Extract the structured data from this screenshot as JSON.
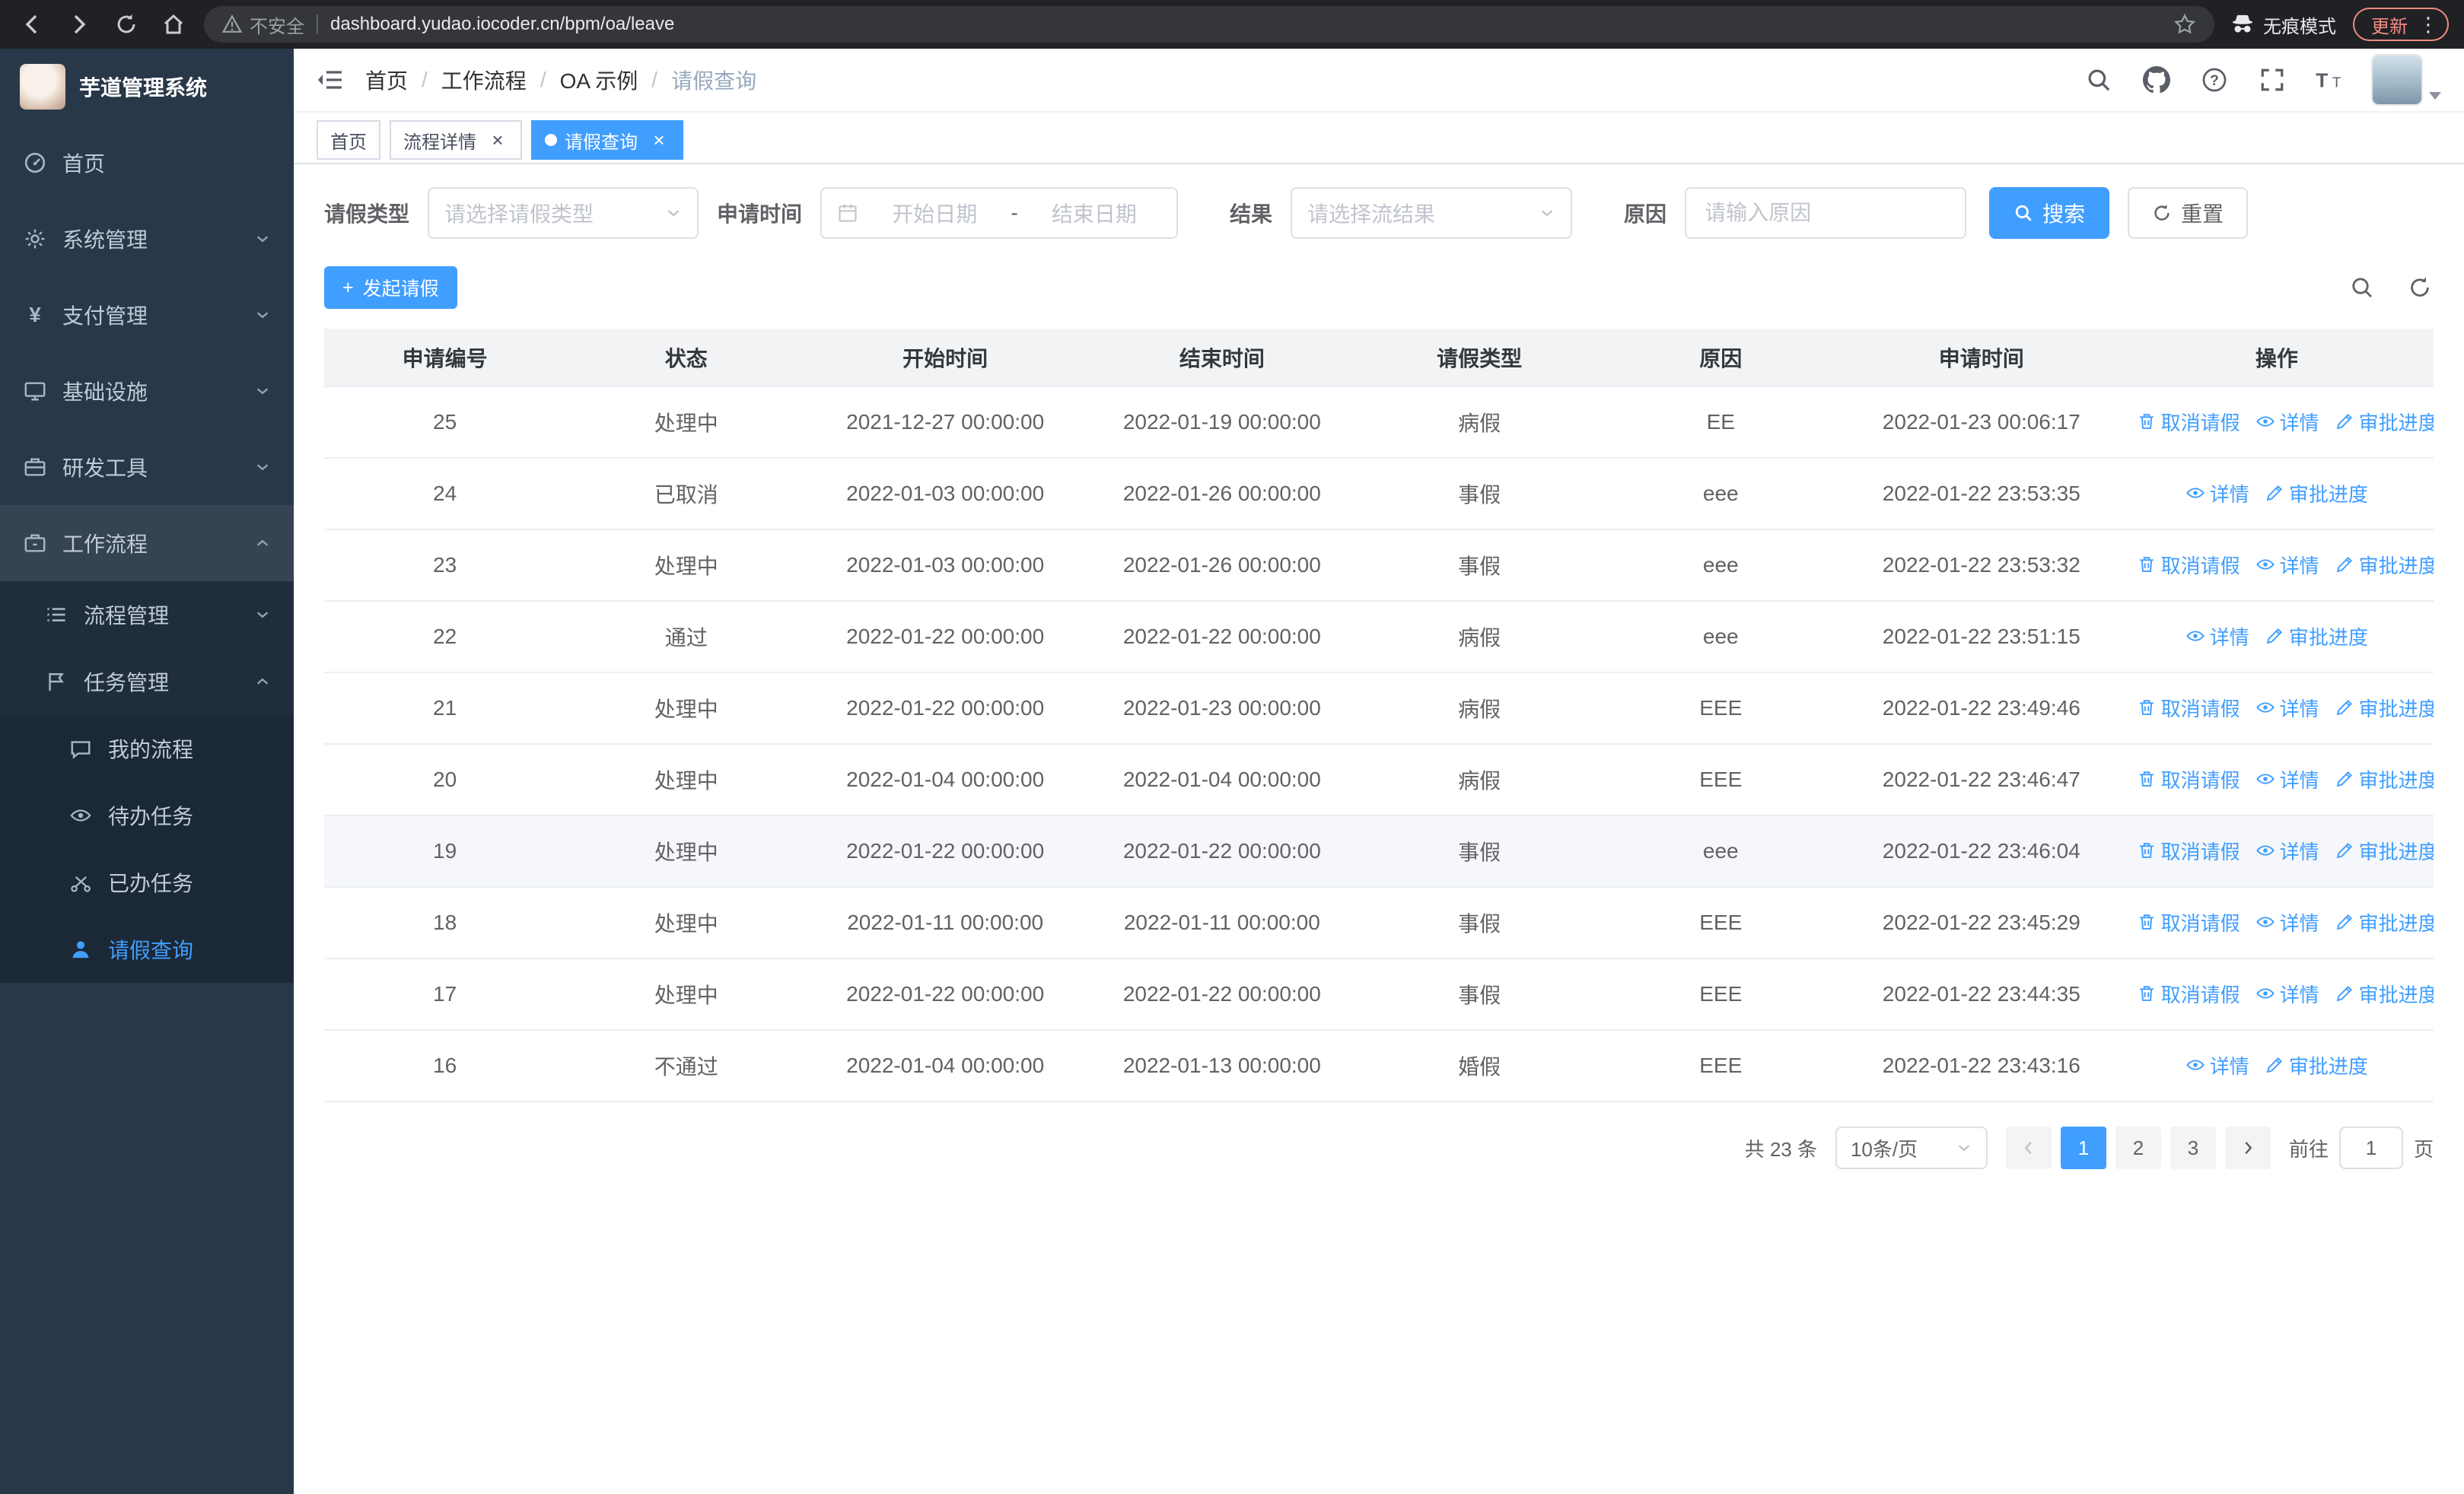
{
  "colors": {
    "accent": "#409eff",
    "sidebar_bg": "#293848",
    "submenu_bg": "#1f2d3d",
    "chrome_bg": "#202124",
    "table_header_bg": "#f2f3f5"
  },
  "browser": {
    "security_label": "不安全",
    "url": "dashboard.yudao.iocoder.cn/bpm/oa/leave",
    "incognito_label": "无痕模式",
    "update_label": "更新"
  },
  "sidebar": {
    "title": "芋道管理系统",
    "menu": [
      {
        "id": "home",
        "label": "首页",
        "icon": "dashboard-icon",
        "level": 1
      },
      {
        "id": "system",
        "label": "系统管理",
        "icon": "gear-icon",
        "level": 1,
        "chevron": "down"
      },
      {
        "id": "payment",
        "label": "支付管理",
        "icon": "payment-icon",
        "level": 1,
        "chevron": "down"
      },
      {
        "id": "infrastructure",
        "label": "基础设施",
        "icon": "infrastructure-icon",
        "level": 1,
        "chevron": "down"
      },
      {
        "id": "devtools",
        "label": "研发工具",
        "icon": "devtools-icon",
        "level": 1,
        "chevron": "down"
      },
      {
        "id": "workflow",
        "label": "工作流程",
        "icon": "workflow-icon",
        "level": 1,
        "chevron": "up",
        "parent_active": true
      },
      {
        "id": "process-management",
        "label": "流程管理",
        "icon": "process-icon",
        "level": 2,
        "chevron": "down"
      },
      {
        "id": "task-management",
        "label": "任务管理",
        "icon": "task-icon",
        "level": 2,
        "chevron": "up"
      },
      {
        "id": "my-process",
        "label": "我的流程",
        "icon": "chat-icon",
        "level": 3
      },
      {
        "id": "todo-tasks",
        "label": "待办任务",
        "icon": "eye-icon",
        "level": 3
      },
      {
        "id": "done-tasks",
        "label": "已办任务",
        "icon": "scissors-icon",
        "level": 3
      },
      {
        "id": "leave-query",
        "label": "请假查询",
        "icon": "user-icon",
        "level": 3,
        "active": true
      }
    ]
  },
  "header": {
    "breadcrumb": [
      "首页",
      "工作流程",
      "OA 示例",
      "请假查询"
    ]
  },
  "tags": [
    {
      "id": "home",
      "label": "首页",
      "active": false,
      "closable": false,
      "dot": false
    },
    {
      "id": "process-detail",
      "label": "流程详情",
      "active": false,
      "closable": true,
      "dot": false
    },
    {
      "id": "leave-query",
      "label": "请假查询",
      "active": true,
      "closable": true,
      "dot": true
    }
  ],
  "filters": {
    "leave_type_label": "请假类型",
    "leave_type_placeholder": "请选择请假类型",
    "apply_time_label": "申请时间",
    "start_date_placeholder": "开始日期",
    "range_separator": "-",
    "end_date_placeholder": "结束日期",
    "result_label": "结果",
    "result_placeholder": "请选择流结果",
    "reason_label": "原因",
    "reason_placeholder": "请输入原因",
    "search_label": "搜索",
    "reset_label": "重置"
  },
  "toolbar": {
    "create_label": "发起请假"
  },
  "table": {
    "columns": [
      "申请编号",
      "状态",
      "开始时间",
      "结束时间",
      "请假类型",
      "原因",
      "申请时间",
      "操作"
    ],
    "action_defs": {
      "cancel": {
        "label": "取消请假",
        "icon": "delete-icon"
      },
      "detail": {
        "label": "详情",
        "icon": "view-icon"
      },
      "progress": {
        "label": "审批进度",
        "icon": "edit-icon"
      }
    },
    "rows": [
      {
        "id": "25",
        "status": "处理中",
        "start_time": "2021-12-27 00:00:00",
        "end_time": "2022-01-19 00:00:00",
        "leave_type": "病假",
        "reason": "EE",
        "apply_time": "2022-01-23 00:06:17",
        "actions": [
          "cancel",
          "detail",
          "progress"
        ]
      },
      {
        "id": "24",
        "status": "已取消",
        "start_time": "2022-01-03 00:00:00",
        "end_time": "2022-01-26 00:00:00",
        "leave_type": "事假",
        "reason": "eee",
        "apply_time": "2022-01-22 23:53:35",
        "actions": [
          "detail",
          "progress"
        ]
      },
      {
        "id": "23",
        "status": "处理中",
        "start_time": "2022-01-03 00:00:00",
        "end_time": "2022-01-26 00:00:00",
        "leave_type": "事假",
        "reason": "eee",
        "apply_time": "2022-01-22 23:53:32",
        "actions": [
          "cancel",
          "detail",
          "progress"
        ]
      },
      {
        "id": "22",
        "status": "通过",
        "start_time": "2022-01-22 00:00:00",
        "end_time": "2022-01-22 00:00:00",
        "leave_type": "病假",
        "reason": "eee",
        "apply_time": "2022-01-22 23:51:15",
        "actions": [
          "detail",
          "progress"
        ]
      },
      {
        "id": "21",
        "status": "处理中",
        "start_time": "2022-01-22 00:00:00",
        "end_time": "2022-01-23 00:00:00",
        "leave_type": "病假",
        "reason": "EEE",
        "apply_time": "2022-01-22 23:49:46",
        "actions": [
          "cancel",
          "detail",
          "progress"
        ]
      },
      {
        "id": "20",
        "status": "处理中",
        "start_time": "2022-01-04 00:00:00",
        "end_time": "2022-01-04 00:00:00",
        "leave_type": "病假",
        "reason": "EEE",
        "apply_time": "2022-01-22 23:46:47",
        "actions": [
          "cancel",
          "detail",
          "progress"
        ]
      },
      {
        "id": "19",
        "status": "处理中",
        "start_time": "2022-01-22 00:00:00",
        "end_time": "2022-01-22 00:00:00",
        "leave_type": "事假",
        "reason": "eee",
        "apply_time": "2022-01-22 23:46:04",
        "actions": [
          "cancel",
          "detail",
          "progress"
        ],
        "highlighted": true
      },
      {
        "id": "18",
        "status": "处理中",
        "start_time": "2022-01-11 00:00:00",
        "end_time": "2022-01-11 00:00:00",
        "leave_type": "事假",
        "reason": "EEE",
        "apply_time": "2022-01-22 23:45:29",
        "actions": [
          "cancel",
          "detail",
          "progress"
        ]
      },
      {
        "id": "17",
        "status": "处理中",
        "start_time": "2022-01-22 00:00:00",
        "end_time": "2022-01-22 00:00:00",
        "leave_type": "事假",
        "reason": "EEE",
        "apply_time": "2022-01-22 23:44:35",
        "actions": [
          "cancel",
          "detail",
          "progress"
        ]
      },
      {
        "id": "16",
        "status": "不通过",
        "start_time": "2022-01-04 00:00:00",
        "end_time": "2022-01-13 00:00:00",
        "leave_type": "婚假",
        "reason": "EEE",
        "apply_time": "2022-01-22 23:43:16",
        "actions": [
          "detail",
          "progress"
        ]
      }
    ]
  },
  "pagination": {
    "total_text": "共 23 条",
    "page_size_text": "10条/页",
    "pages": [
      "1",
      "2",
      "3"
    ],
    "active_page": "1",
    "goto_prefix": "前往",
    "goto_value": "1",
    "goto_suffix": "页"
  }
}
